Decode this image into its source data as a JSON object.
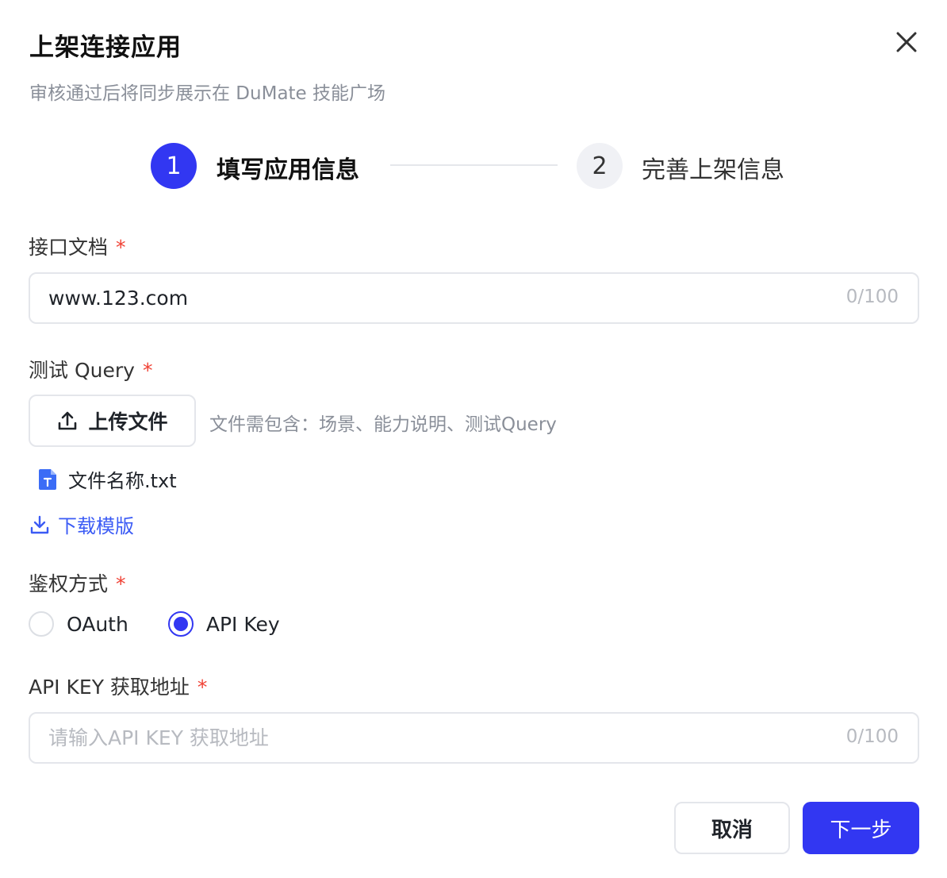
{
  "dialog": {
    "title": "上架连接应用",
    "subtitle": "审核通过后将同步展示在 DuMate 技能广场",
    "close_icon": "close-icon"
  },
  "stepper": {
    "steps": [
      {
        "number": "1",
        "label": "填写应用信息",
        "active": true
      },
      {
        "number": "2",
        "label": "完善上架信息",
        "active": false
      }
    ]
  },
  "form": {
    "api_doc": {
      "label": "接口文档",
      "required_mark": "*",
      "value": "www.123.com",
      "counter": "0/100"
    },
    "test_query": {
      "label": "测试 Query",
      "required_mark": "*",
      "upload_label": "上传文件",
      "upload_icon": "upload-icon",
      "hint": "文件需包含：场景、能力说明、测试Query",
      "file_name": "文件名称.txt",
      "file_icon": "txt-file-icon",
      "download_label": "下载模版",
      "download_icon": "download-icon"
    },
    "auth": {
      "label": "鉴权方式",
      "required_mark": "*",
      "options": [
        {
          "label": "OAuth",
          "checked": false
        },
        {
          "label": "API Key",
          "checked": true
        }
      ]
    },
    "api_key_url": {
      "label": "API KEY 获取地址",
      "required_mark": "*",
      "placeholder": "请输入API KEY 获取地址",
      "counter": "0/100"
    }
  },
  "footer": {
    "cancel_label": "取消",
    "next_label": "下一步"
  },
  "colors": {
    "primary": "#3237f2",
    "link": "#3b5bf5",
    "required": "#f04134"
  }
}
